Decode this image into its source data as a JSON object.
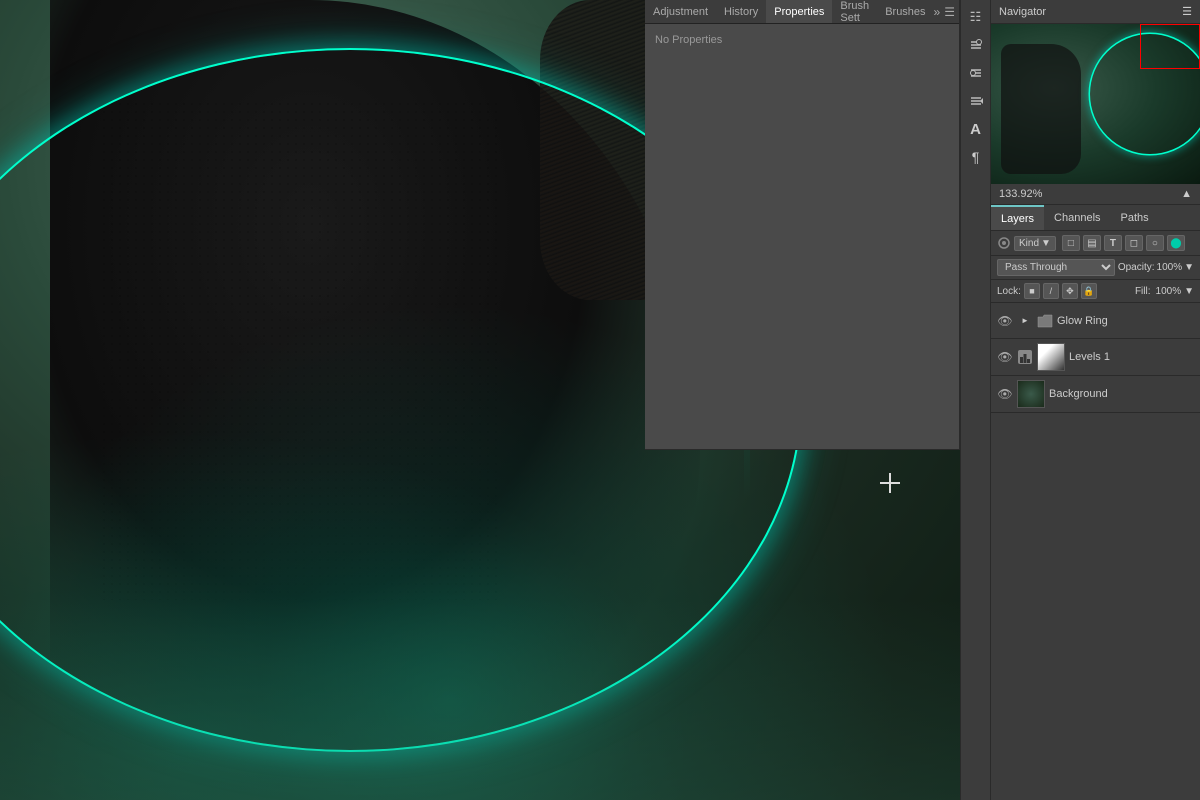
{
  "tabs": {
    "adjustment": "Adjustment",
    "history": "History",
    "properties": "Properties",
    "brush_settings": "Brush Sett",
    "brushes": "Brushes"
  },
  "properties": {
    "no_properties": "No Properties"
  },
  "navigator": {
    "title": "Navigator"
  },
  "zoom": {
    "level": "133.92%"
  },
  "layers": {
    "tab_layers": "Layers",
    "tab_channels": "Channels",
    "tab_paths": "Paths",
    "filter_kind": "Kind",
    "blend_mode": "Pass Through",
    "opacity_label": "Opacity:",
    "opacity_value": "100%",
    "fill_label": "Fill:",
    "fill_value": "100%",
    "lock_label": "Lock:",
    "items": [
      {
        "name": "Glow Ring",
        "type": "folder",
        "visible": true
      },
      {
        "name": "Levels 1",
        "type": "adjustment",
        "visible": true
      },
      {
        "name": "Background",
        "type": "image",
        "visible": true
      }
    ]
  },
  "toolbar_icons": {
    "icon1": "⊞",
    "icon2": "≡",
    "icon3": "≡",
    "icon4": "→",
    "icon5": "A",
    "icon6": "¶"
  }
}
